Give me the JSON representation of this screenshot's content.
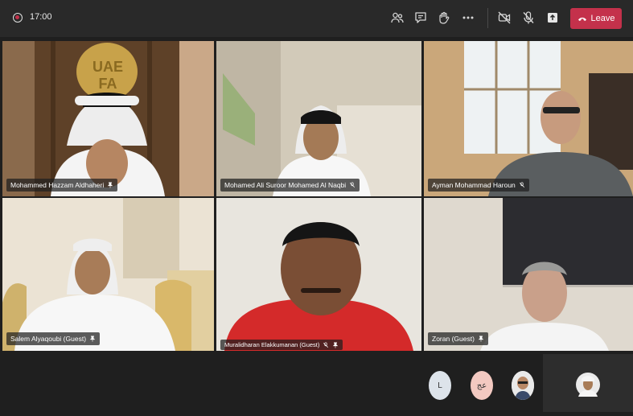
{
  "topbar": {
    "time": "17:00",
    "leave_label": "Leave",
    "icons": [
      "people-icon",
      "chat-icon",
      "raise-hand-icon",
      "more-icon",
      "camera-off-icon",
      "mic-off-icon",
      "share-icon"
    ]
  },
  "participants": [
    {
      "name": "Mohammed Hazzam Aldhaheri",
      "logo_text": "UAE FA",
      "pinned": true,
      "muted": false
    },
    {
      "name": "Mohamed Ali Suroor Mohamed Al Naqbi",
      "pinned": false,
      "muted": true
    },
    {
      "name": "Ayman Mohammad Haroun",
      "pinned": false,
      "muted": true
    },
    {
      "name": "Salem Alyaqoubi (Guest)",
      "pinned": true,
      "muted": false
    },
    {
      "name": "Muralidharan Elakkumanan (Guest)",
      "pinned": true,
      "muted": true
    },
    {
      "name": "Zoran (Guest)",
      "pinned": true,
      "muted": false
    }
  ],
  "bottom_avatars": [
    {
      "initials": "L",
      "color": "#dde3ea"
    },
    {
      "initials": "عج",
      "color": "#f3c9c1"
    },
    {
      "initials": "",
      "color": "#e9e9e9"
    }
  ],
  "colors": {
    "leave": "#c4314b",
    "topbar": "#292929",
    "background": "#1f1f1f"
  }
}
